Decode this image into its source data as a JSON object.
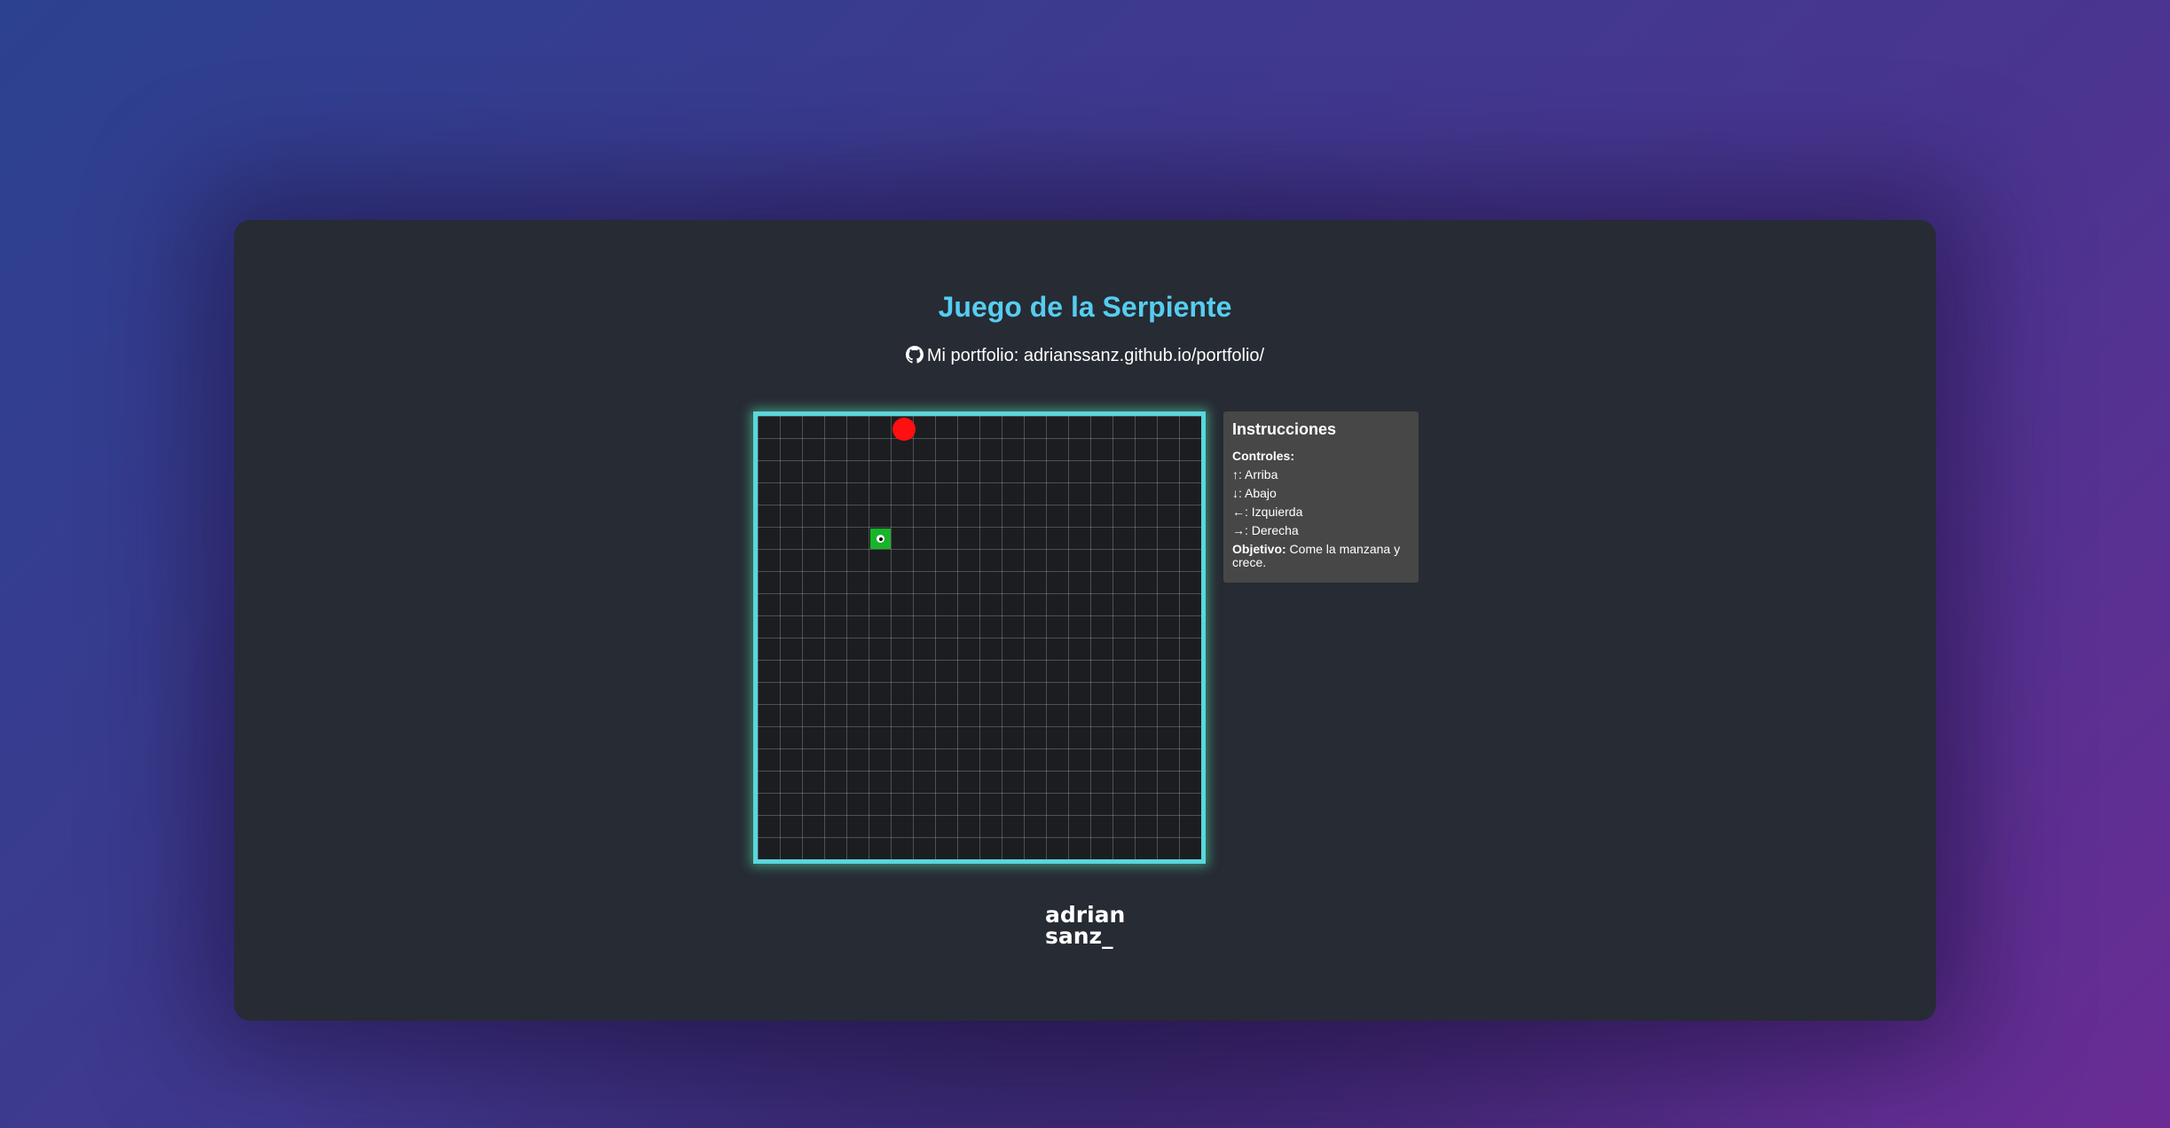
{
  "page": {
    "title": "Juego de la Serpiente",
    "portfolio_text": "Mi portfolio: adrianssanz.github.io/portfolio/"
  },
  "game": {
    "grid_cols": 20,
    "grid_rows": 20,
    "apple_cell": {
      "col": 6,
      "row": 0
    },
    "snake": [
      {
        "col": 5,
        "row": 5
      }
    ],
    "direction": "right"
  },
  "instructions": {
    "title": "Instrucciones",
    "controls_label": "Controles:",
    "controls": [
      {
        "key": "↑",
        "action": ": Arriba"
      },
      {
        "key": "↓",
        "action": ": Abajo"
      },
      {
        "key": "←",
        "action": ": Izquierda"
      },
      {
        "key": "→",
        "action": ": Derecha"
      }
    ],
    "objective_label": "Objetivo:",
    "objective_text": " Come la manzana y crece."
  },
  "logo": {
    "line1": "adrian",
    "line2": "sanz_"
  },
  "colors": {
    "title": "#55cdf0",
    "board_border": "#5ad7dc",
    "apple": "#ff0f0f",
    "snake": "#18b42a",
    "card": "#272b33",
    "instructions_bg": "#474747"
  },
  "icons": {
    "portfolio_icon": "github-icon"
  }
}
